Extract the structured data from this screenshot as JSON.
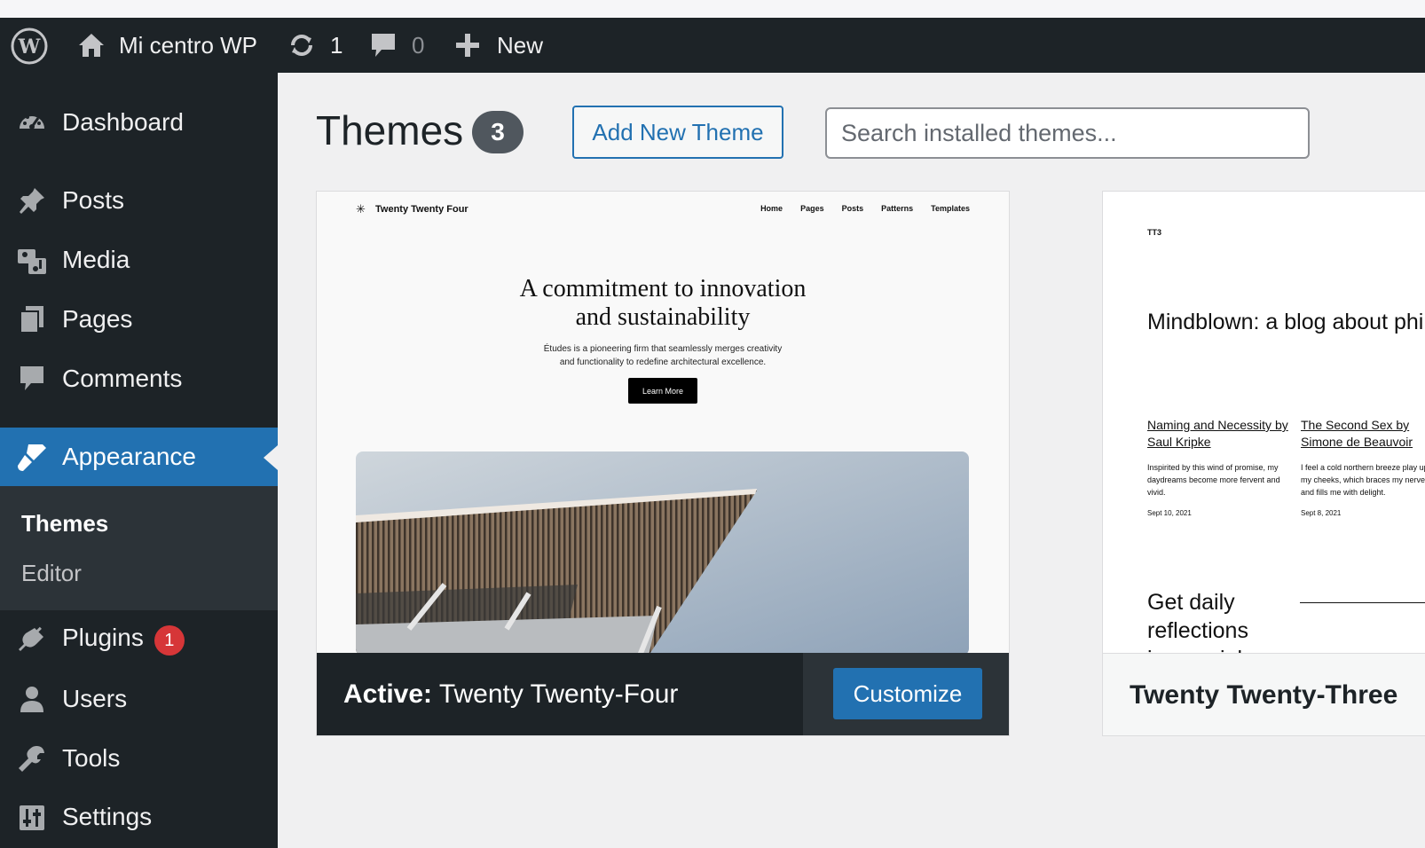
{
  "admin_bar": {
    "site_name": "Mi centro WP",
    "updates_count": "1",
    "comments_count": "0",
    "new_label": "New"
  },
  "sidebar": {
    "items": [
      {
        "label": "Dashboard",
        "icon": "dashboard-icon"
      },
      {
        "label": "Posts",
        "icon": "pin-icon"
      },
      {
        "label": "Media",
        "icon": "media-icon"
      },
      {
        "label": "Pages",
        "icon": "pages-icon"
      },
      {
        "label": "Comments",
        "icon": "comment-icon"
      },
      {
        "label": "Appearance",
        "icon": "brush-icon"
      },
      {
        "label": "Plugins",
        "icon": "plugin-icon",
        "badge": "1"
      },
      {
        "label": "Users",
        "icon": "user-icon"
      },
      {
        "label": "Tools",
        "icon": "wrench-icon"
      },
      {
        "label": "Settings",
        "icon": "sliders-icon"
      }
    ],
    "appearance_submenu": [
      {
        "label": "Themes"
      },
      {
        "label": "Editor"
      }
    ]
  },
  "main": {
    "title": "Themes",
    "theme_count": "3",
    "add_new_label": "Add New Theme",
    "search_placeholder": "Search installed themes..."
  },
  "themes": [
    {
      "active_prefix": "Active:",
      "name": "Twenty Twenty-Four",
      "customize_label": "Customize",
      "preview": {
        "site_title": "Twenty Twenty Four",
        "nav": [
          "Home",
          "Pages",
          "Posts",
          "Patterns",
          "Templates"
        ],
        "headline_line1": "A commitment to innovation",
        "headline_line2": "and sustainability",
        "body_line1": "Études is a pioneering firm that seamlessly merges creativity",
        "body_line2": "and functionality to redefine architectural excellence.",
        "button": "Learn More"
      }
    },
    {
      "name": "Twenty Twenty-Three",
      "preview": {
        "logo": "TT3",
        "title": "Mindblown: a blog about philosophy.",
        "posts": [
          {
            "title": "Naming and Necessity by Saul Kripke",
            "excerpt": "Inspirited by this wind of promise, my daydreams become more fervent and vivid.",
            "date": "Sept 10, 2021"
          },
          {
            "title": "The Second Sex by Simone de Beauvoir",
            "excerpt": "I feel a cold northern breeze play upon my cheeks, which braces my nerves and fills me with delight.",
            "date": "Sept 8, 2021"
          }
        ],
        "subscribe_line1": "Get daily",
        "subscribe_line2": "reflections",
        "subscribe_line3": "in your inbox"
      }
    }
  ],
  "colors": {
    "admin_dark": "#1d2327",
    "accent_blue": "#2271b1",
    "badge_red": "#d63638"
  }
}
